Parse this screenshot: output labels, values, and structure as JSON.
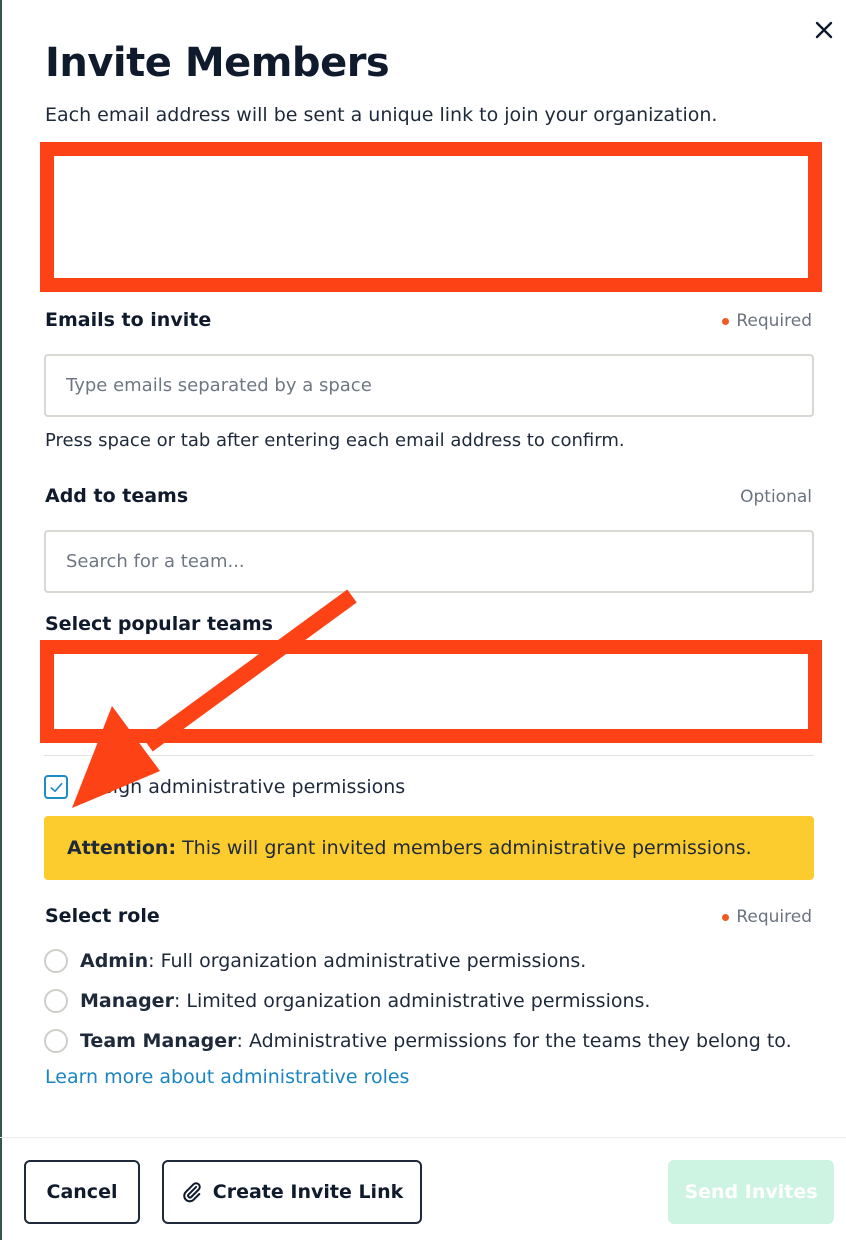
{
  "modal": {
    "title": "Invite Members",
    "subtitle": "Each email address will be sent a unique link to join your organization."
  },
  "emails": {
    "label": "Emails to invite",
    "required_text": "Required",
    "placeholder": "Type emails separated by a space",
    "helper": "Press space or tab after entering each email address to confirm."
  },
  "teams": {
    "label": "Add to teams",
    "optional_text": "Optional",
    "placeholder": "Search for a team...",
    "popular_label": "Select popular teams"
  },
  "admin": {
    "checkbox_label": "Assign administrative permissions",
    "checked": true,
    "alert_bold": "Attention:",
    "alert_text": "This will grant invited members administrative permissions."
  },
  "role": {
    "label": "Select role",
    "required_text": "Required",
    "options": [
      {
        "name": "Admin",
        "desc": ": Full organization administrative permissions."
      },
      {
        "name": "Manager",
        "desc": ": Limited organization administrative permissions."
      },
      {
        "name": "Team Manager",
        "desc": ": Administrative permissions for the teams they belong to."
      }
    ],
    "learn_more": "Learn more about administrative roles"
  },
  "footer": {
    "cancel": "Cancel",
    "create_link": "Create Invite Link",
    "send": "Send Invites"
  },
  "colors": {
    "annotation": "#fd4316",
    "alert_bg": "#fccb2e",
    "link": "#1a85c2",
    "send_disabled_bg": "#cdf4e2"
  },
  "icons": {
    "close": "close-icon",
    "check": "check-icon",
    "paperclip": "paperclip-icon"
  }
}
